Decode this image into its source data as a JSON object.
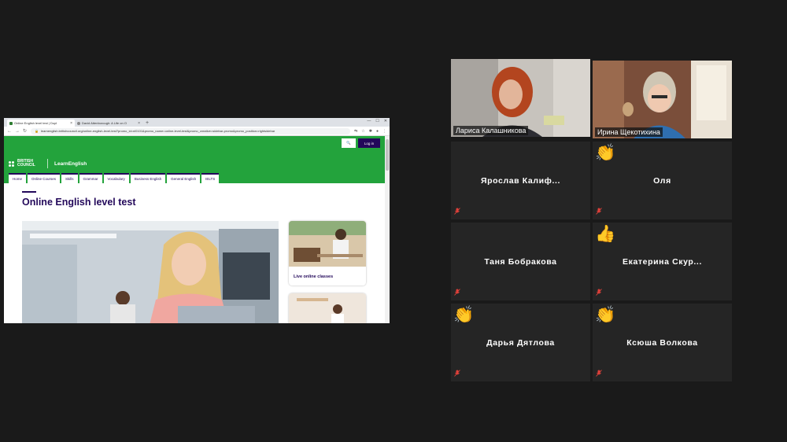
{
  "browser": {
    "tabs": [
      {
        "title": "Online English level test | Dupl",
        "active": true
      },
      {
        "title": "David Attenborough: A Life on O",
        "active": false
      }
    ],
    "new_tab_label": "+",
    "url": "learnenglish.britishcouncil.org/online-english-level-test?promo_id=nl0101&promo_name=online-level-test&promo_creative=sidebar-promo&promo_position=rightsidebar"
  },
  "site": {
    "brand_line1": "BRITISH",
    "brand_line2": "COUNCIL",
    "product": "LearnEnglish",
    "login_label": "Log in",
    "nav": [
      "Home",
      "Online Courses",
      "Skills",
      "Grammar",
      "Vocabulary",
      "Business English",
      "General English",
      "IELTS"
    ],
    "page_title": "Online English level test",
    "cards": [
      {
        "label": "Live online classes"
      },
      {
        "label": ""
      }
    ]
  },
  "participants": [
    {
      "name": "Лариса Калашникова",
      "video": true,
      "active_speaker": true,
      "reaction": ""
    },
    {
      "name": "Ирина Щекотихина",
      "video": true,
      "active_speaker": false,
      "reaction": ""
    },
    {
      "name": "Ярослав  Калиф...",
      "video": false,
      "muted": true,
      "reaction": ""
    },
    {
      "name": "Оля",
      "video": false,
      "muted": true,
      "reaction": "👏"
    },
    {
      "name": "Таня Бобракова",
      "video": false,
      "muted": true,
      "reaction": ""
    },
    {
      "name": "Екатерина  Скур...",
      "video": false,
      "muted": true,
      "reaction": "👍"
    },
    {
      "name": "Дарья Дятлова",
      "video": false,
      "muted": true,
      "reaction": "👏"
    },
    {
      "name": "Ксюша Волкова",
      "video": false,
      "muted": true,
      "reaction": "👏"
    }
  ],
  "colors": {
    "brand_green": "#23a33c",
    "brand_indigo": "#23085a",
    "active_speaker_border": "#e4e87a",
    "muted_mic": "#e0403a"
  }
}
